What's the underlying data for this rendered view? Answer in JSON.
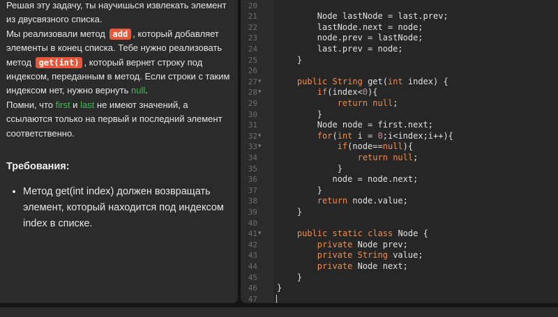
{
  "task": {
    "intro": "Решая эту задачу, ты научишься извлекать элемент из двусвязного списка.",
    "p2_a": "Мы реализовали метод ",
    "add_chip": "add",
    "p2_b": ", который добавляет элементы в конец списка. Тебе нужно реализовать метод ",
    "get_chip": "get(int)",
    "p2_c": ", который вернет строку под индексом, переданным в метод. Если строки с таким индексом нет, нужно вернуть ",
    "null_word": "null",
    "p2_d": ".",
    "p3_a": "Помни, что ",
    "first_word": "first",
    "p3_b": " и ",
    "last_word": "last",
    "p3_c": " не имеют значений, а ссылаются только на первый и последний элемент соответственно.",
    "requirements_title": "Требования:",
    "requirements": [
      "Метод get(int index) должен возвращать элемент, который находится под индексом index в списке."
    ]
  },
  "editor": {
    "lines": [
      {
        "n": "20",
        "fold": false,
        "code": ""
      },
      {
        "n": "21",
        "fold": false,
        "code": "        Node lastNode = last.prev;"
      },
      {
        "n": "22",
        "fold": false,
        "code": "        lastNode.next = node;"
      },
      {
        "n": "23",
        "fold": false,
        "code": "        node.prev = lastNode;"
      },
      {
        "n": "24",
        "fold": false,
        "code": "        last.prev = node;"
      },
      {
        "n": "25",
        "fold": false,
        "code": "    }"
      },
      {
        "n": "26",
        "fold": false,
        "code": ""
      },
      {
        "n": "27",
        "fold": true,
        "code": "    public String get(int index) {"
      },
      {
        "n": "28",
        "fold": true,
        "code": "        if(index<0){"
      },
      {
        "n": "29",
        "fold": false,
        "code": "            return null;"
      },
      {
        "n": "30",
        "fold": false,
        "code": "        }"
      },
      {
        "n": "31",
        "fold": false,
        "code": "        Node node = first.next;"
      },
      {
        "n": "32",
        "fold": true,
        "code": "        for(int i = 0;i<index;i++){"
      },
      {
        "n": "33",
        "fold": true,
        "code": "            if(node==null){"
      },
      {
        "n": "34",
        "fold": false,
        "code": "                return null;"
      },
      {
        "n": "35",
        "fold": false,
        "code": "            }"
      },
      {
        "n": "36",
        "fold": false,
        "code": "           node = node.next;"
      },
      {
        "n": "37",
        "fold": false,
        "code": "        }"
      },
      {
        "n": "38",
        "fold": false,
        "code": "        return node.value;"
      },
      {
        "n": "39",
        "fold": false,
        "code": "    }"
      },
      {
        "n": "40",
        "fold": false,
        "code": ""
      },
      {
        "n": "41",
        "fold": true,
        "code": "    public static class Node {"
      },
      {
        "n": "42",
        "fold": false,
        "code": "        private Node prev;"
      },
      {
        "n": "43",
        "fold": false,
        "code": "        private String value;"
      },
      {
        "n": "44",
        "fold": false,
        "code": "        private Node next;"
      },
      {
        "n": "45",
        "fold": false,
        "code": "    }"
      },
      {
        "n": "46",
        "fold": false,
        "code": "}"
      },
      {
        "n": "47",
        "fold": false,
        "code": ""
      }
    ],
    "keywords": [
      "public",
      "String",
      "int",
      "if",
      "return",
      "null",
      "for",
      "private",
      "static",
      "class"
    ],
    "colors": {
      "keyword": "#f08d49",
      "number": "#d3869b",
      "text": "#e0e0e0",
      "chip": "#e8573a",
      "highlight": "#3dbb55"
    }
  }
}
